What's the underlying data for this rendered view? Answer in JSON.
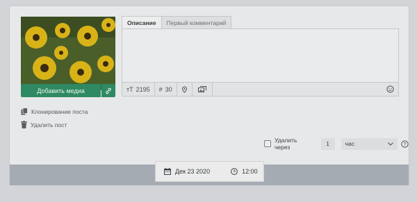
{
  "media": {
    "add_label": "Добавить медиа",
    "link_icon": "link-icon",
    "photo_icon": "flower-photo"
  },
  "editor": {
    "tabs": [
      {
        "label": "Описание",
        "active": true
      },
      {
        "label": "Первый комментарий",
        "active": false
      }
    ],
    "text_value": "",
    "toolbar": {
      "char_count": "2195",
      "hashtag_count": "30",
      "icons": [
        "text-size-icon",
        "hashtag-icon",
        "location-icon",
        "gallery-icon",
        "emoji-icon"
      ]
    }
  },
  "actions": {
    "clone_label": "Клонирование поста",
    "delete_label": "Удалить пост"
  },
  "auto_delete": {
    "label": "Удалить через",
    "amount": "1",
    "unit": "час",
    "checked": false
  },
  "publish": {
    "date": "Дек 23 2020",
    "time": "12:00"
  },
  "colors": {
    "accent_green": "#2f8a63",
    "overlay": "#d2d4d7"
  }
}
